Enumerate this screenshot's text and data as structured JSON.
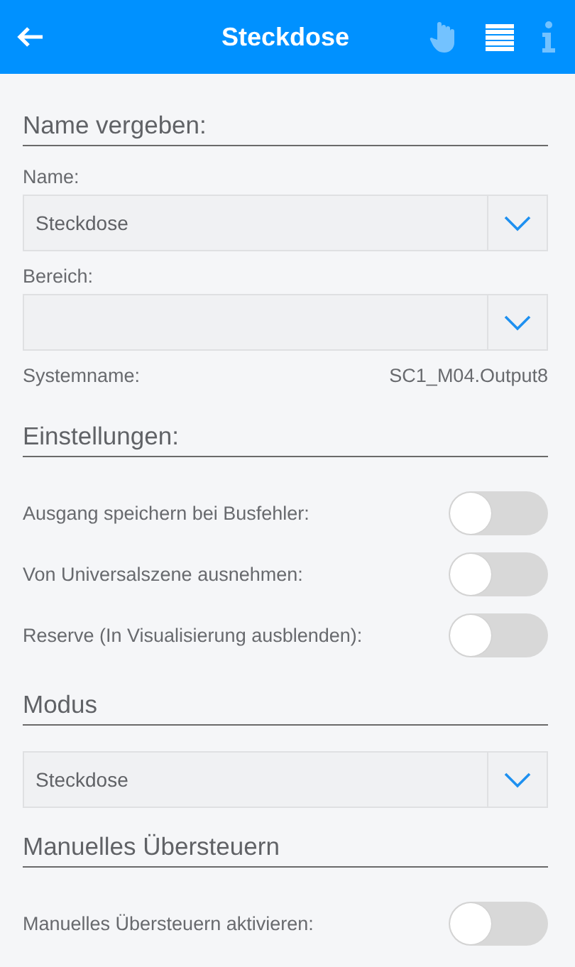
{
  "header": {
    "title": "Steckdose",
    "actions": [
      {
        "kind": "hand",
        "disabled": true
      },
      {
        "kind": "list",
        "disabled": false
      },
      {
        "kind": "info",
        "disabled": true
      }
    ]
  },
  "sections": [
    {
      "title": "Name vergeben:",
      "items": [
        {
          "kind": "dropdown",
          "label": "Name:",
          "value": "Steckdose"
        },
        {
          "kind": "dropdown",
          "label": "Bereich:"
        },
        {
          "kind": "info",
          "label": "Systemname:",
          "value": "SC1_M04.Output8"
        }
      ]
    },
    {
      "title": "Einstellungen:",
      "items": [
        {
          "kind": "toggle",
          "label": "Ausgang speichern bei Busfehler:",
          "on": false
        },
        {
          "kind": "toggle",
          "label": "Von Universalszene ausnehmen:",
          "on": false
        },
        {
          "kind": "toggle",
          "label": "Reserve (In Visualisierung ausblenden):",
          "on": false
        }
      ]
    },
    {
      "title": "Modus",
      "items": [
        {
          "kind": "dropdown",
          "value": "Steckdose"
        }
      ]
    },
    {
      "title": "Manuelles Übersteuern",
      "items": [
        {
          "kind": "toggle",
          "label": "Manuelles Übersteuern aktivieren:",
          "on": false
        }
      ]
    }
  ]
}
